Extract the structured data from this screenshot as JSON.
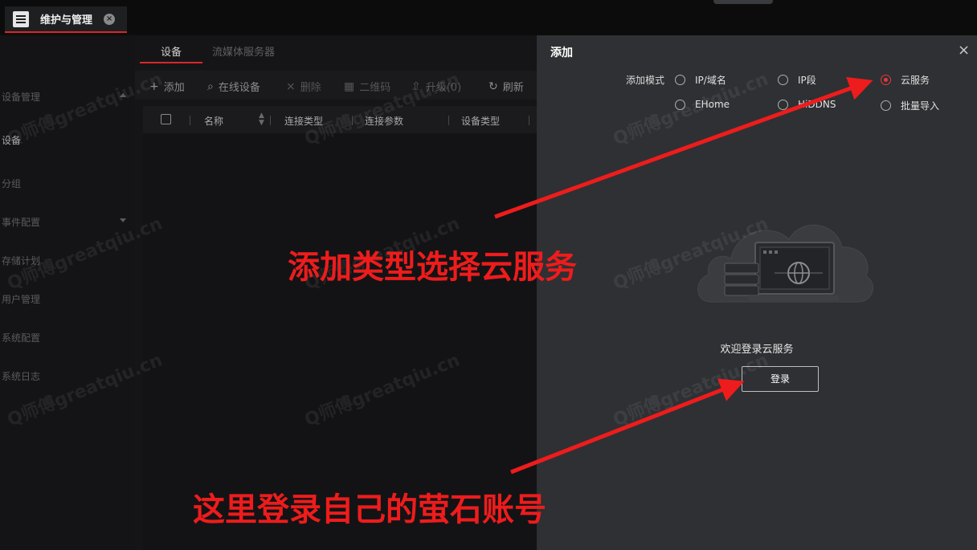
{
  "app_tab": {
    "label": "维护与管理",
    "close": "×"
  },
  "sidebar": {
    "items": [
      {
        "label": "设备管理"
      },
      {
        "label": "设备"
      },
      {
        "label": "分组"
      },
      {
        "label": "事件配置"
      },
      {
        "label": "存储计划"
      },
      {
        "label": "用户管理"
      },
      {
        "label": "系统配置"
      },
      {
        "label": "系统日志"
      }
    ]
  },
  "main": {
    "tabs": [
      {
        "label": "设备"
      },
      {
        "label": "流媒体服务器"
      }
    ],
    "toolbar": [
      {
        "label": "添加",
        "icon": "plus-icon",
        "glyph": "+"
      },
      {
        "label": "在线设备",
        "icon": "search-icon",
        "glyph": "⌕"
      },
      {
        "label": "删除",
        "icon": "close-icon",
        "glyph": "×"
      },
      {
        "label": "二维码",
        "icon": "qr-code-icon",
        "glyph": "▦"
      },
      {
        "label": "升级(0)",
        "icon": "upgrade-icon",
        "glyph": "⇧"
      },
      {
        "label": "刷新",
        "icon": "refresh-icon",
        "glyph": "↻"
      }
    ],
    "columns": [
      "名称",
      "连接类型",
      "连接参数",
      "设备类型"
    ]
  },
  "panel": {
    "title": "添加",
    "close": "×",
    "mode_label": "添加模式",
    "modes": [
      {
        "label": "IP/域名",
        "checked": false
      },
      {
        "label": "IP段",
        "checked": false
      },
      {
        "label": "云服务",
        "checked": true
      },
      {
        "label": "EHome",
        "checked": false
      },
      {
        "label": "HiDDNS",
        "checked": false
      },
      {
        "label": "批量导入",
        "checked": false
      }
    ],
    "welcome": "欢迎登录云服务",
    "login_label": "登录"
  },
  "annotations": {
    "select_cloud": "添加类型选择云服务",
    "login_account": "这里登录自己的萤石账号"
  },
  "watermark": "Q师傅greatqiu.cn",
  "colors": {
    "accent": "#d9262a",
    "annotation": "#ee1c1c",
    "panel_bg": "#2f3033"
  }
}
